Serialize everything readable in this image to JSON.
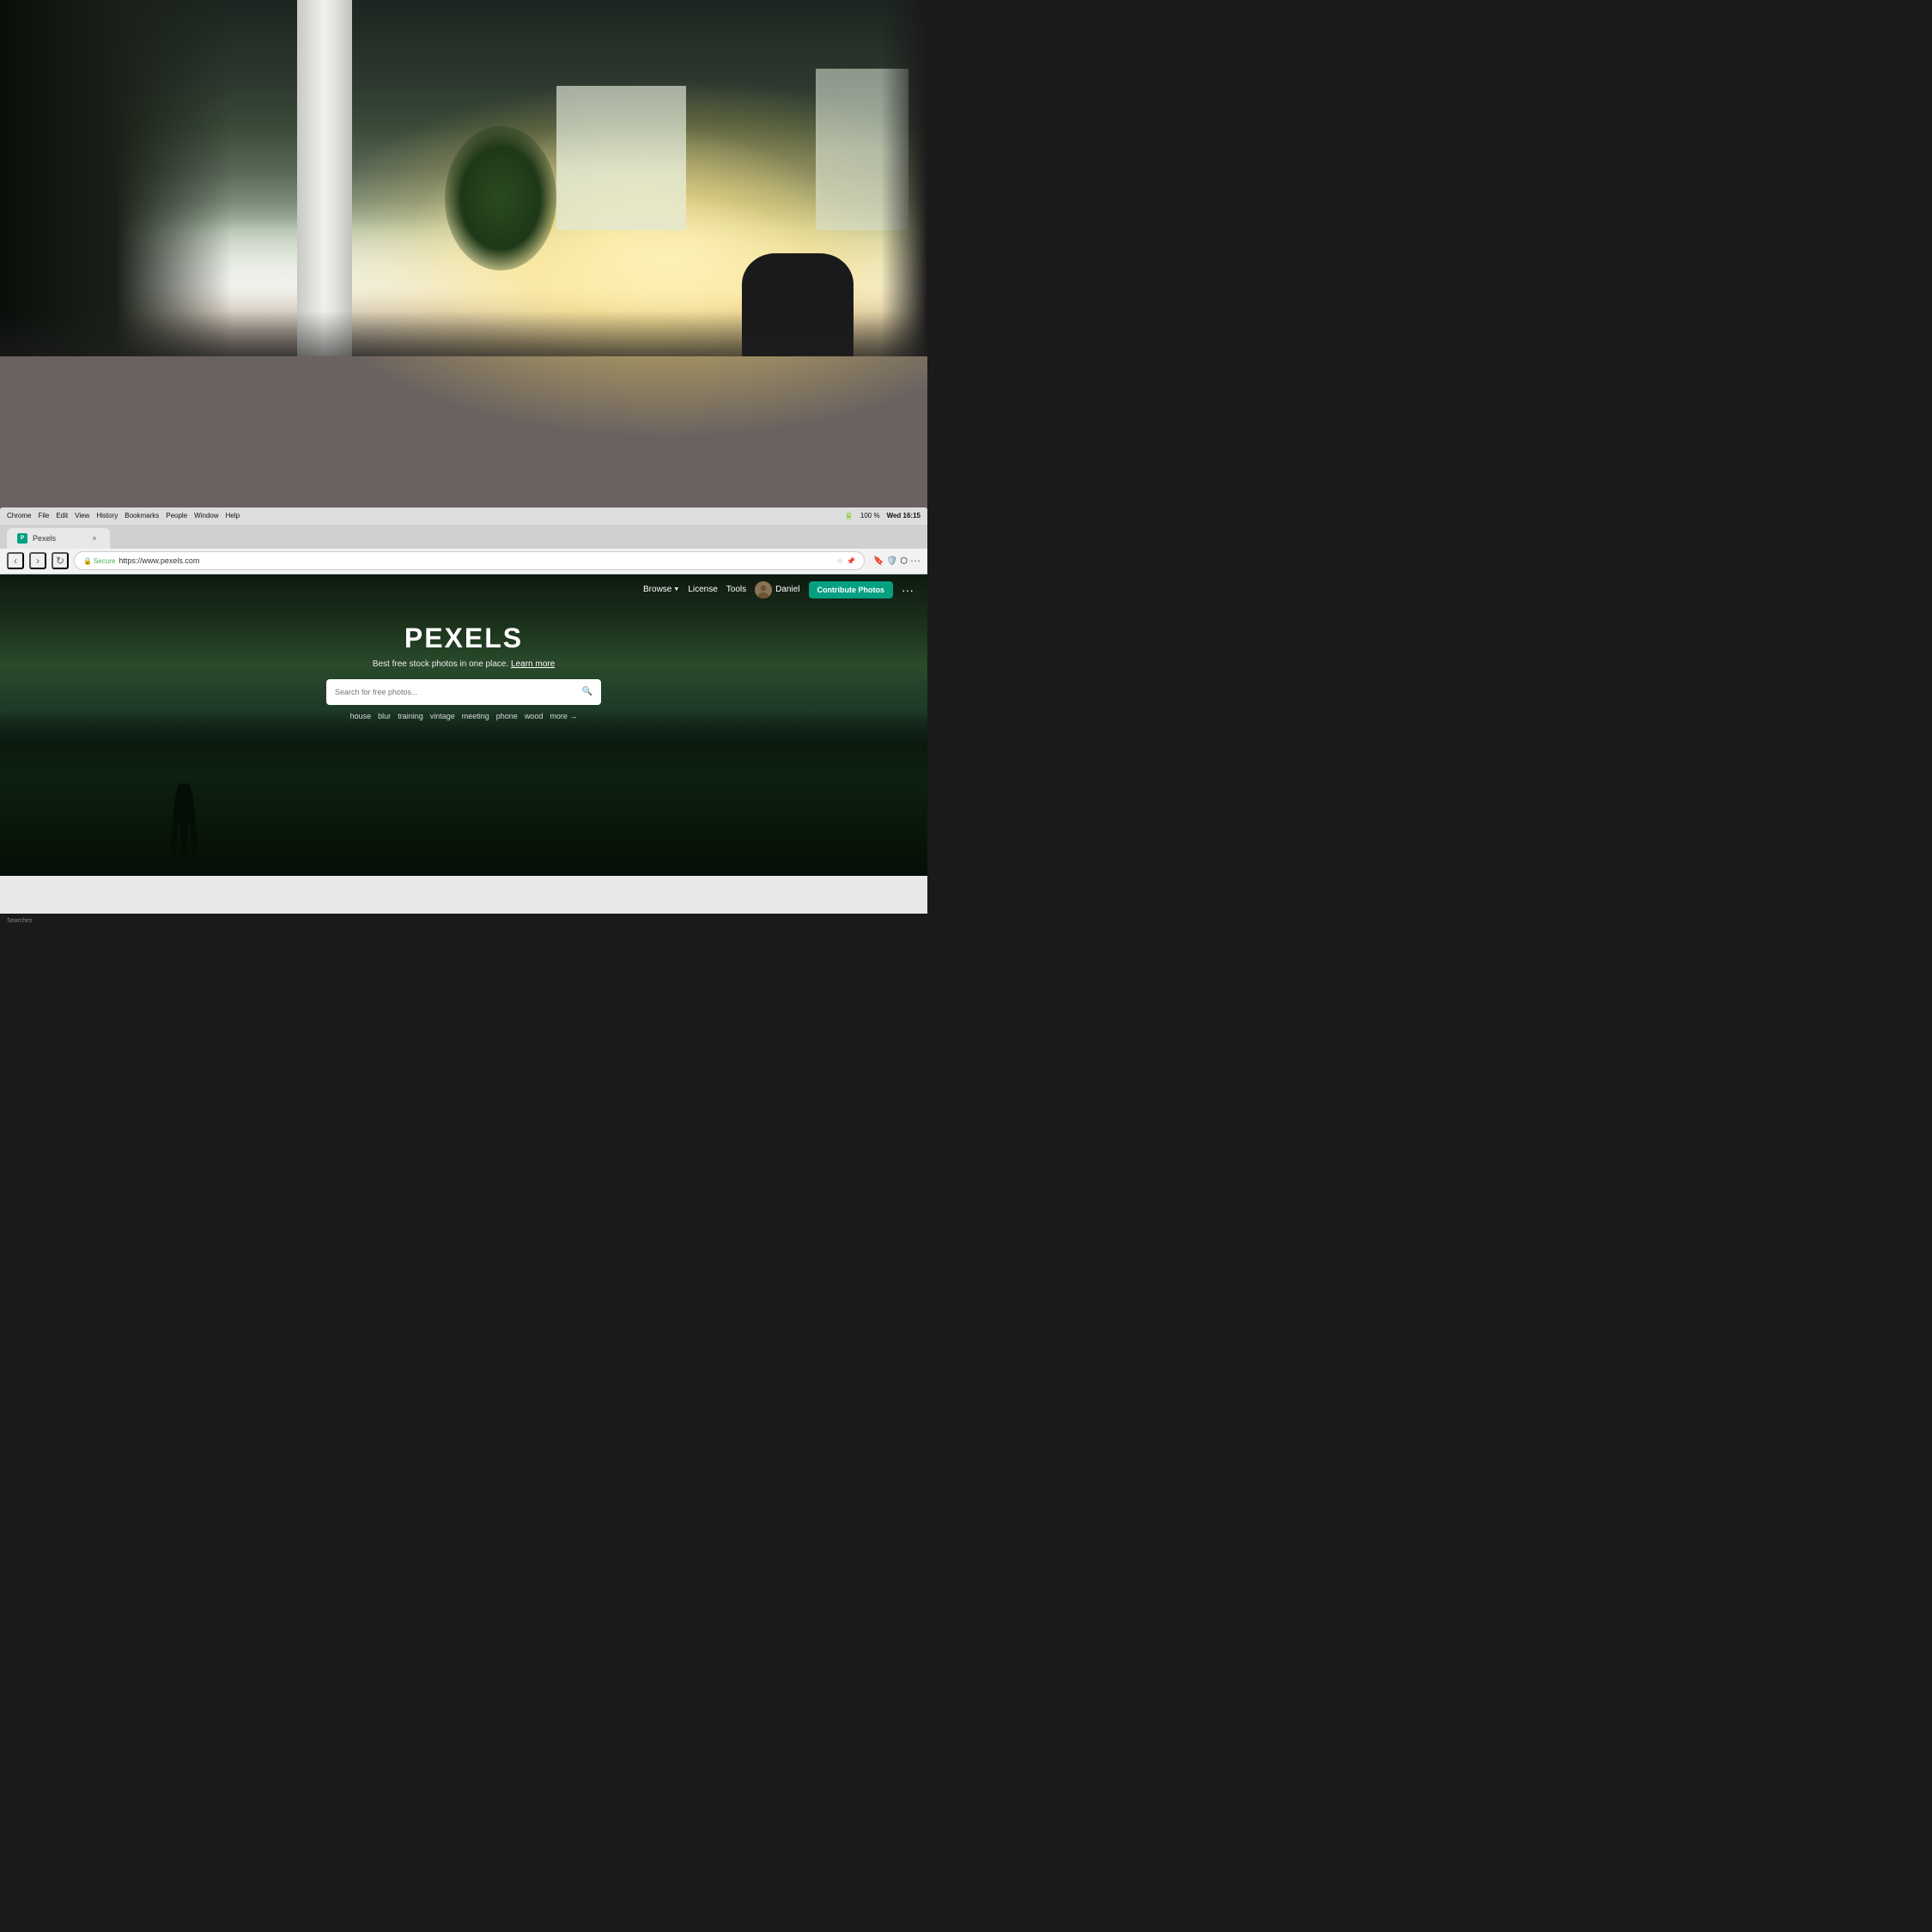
{
  "background": {
    "description": "Office background photo with blurred interior"
  },
  "macos": {
    "menubar": {
      "appName": "Chrome",
      "menus": [
        "File",
        "Edit",
        "View",
        "History",
        "Bookmarks",
        "People",
        "Window",
        "Help"
      ],
      "time": "Wed 16:15",
      "battery": "100 %"
    }
  },
  "browser": {
    "tab": {
      "favicon": "P",
      "title": "Pexels",
      "close": "×"
    },
    "toolbar": {
      "back": "‹",
      "forward": "›",
      "reload": "↻",
      "secure_label": "Secure",
      "url": "https://www.pexels.com",
      "more_label": "···"
    }
  },
  "pexels": {
    "nav": {
      "browse_label": "Browse",
      "license_label": "License",
      "tools_label": "Tools",
      "user_label": "Daniel",
      "contribute_label": "Contribute Photos",
      "more_label": "···"
    },
    "hero": {
      "logo": "PEXELS",
      "tagline": "Best free stock photos in one place.",
      "learn_more": "Learn more",
      "search_placeholder": "Search for free photos...",
      "search_icon": "🔍",
      "tags": [
        "house",
        "blur",
        "training",
        "vintage",
        "meeting",
        "phone",
        "wood"
      ],
      "more_label": "more →"
    }
  },
  "statusbar": {
    "text": "Searches"
  }
}
